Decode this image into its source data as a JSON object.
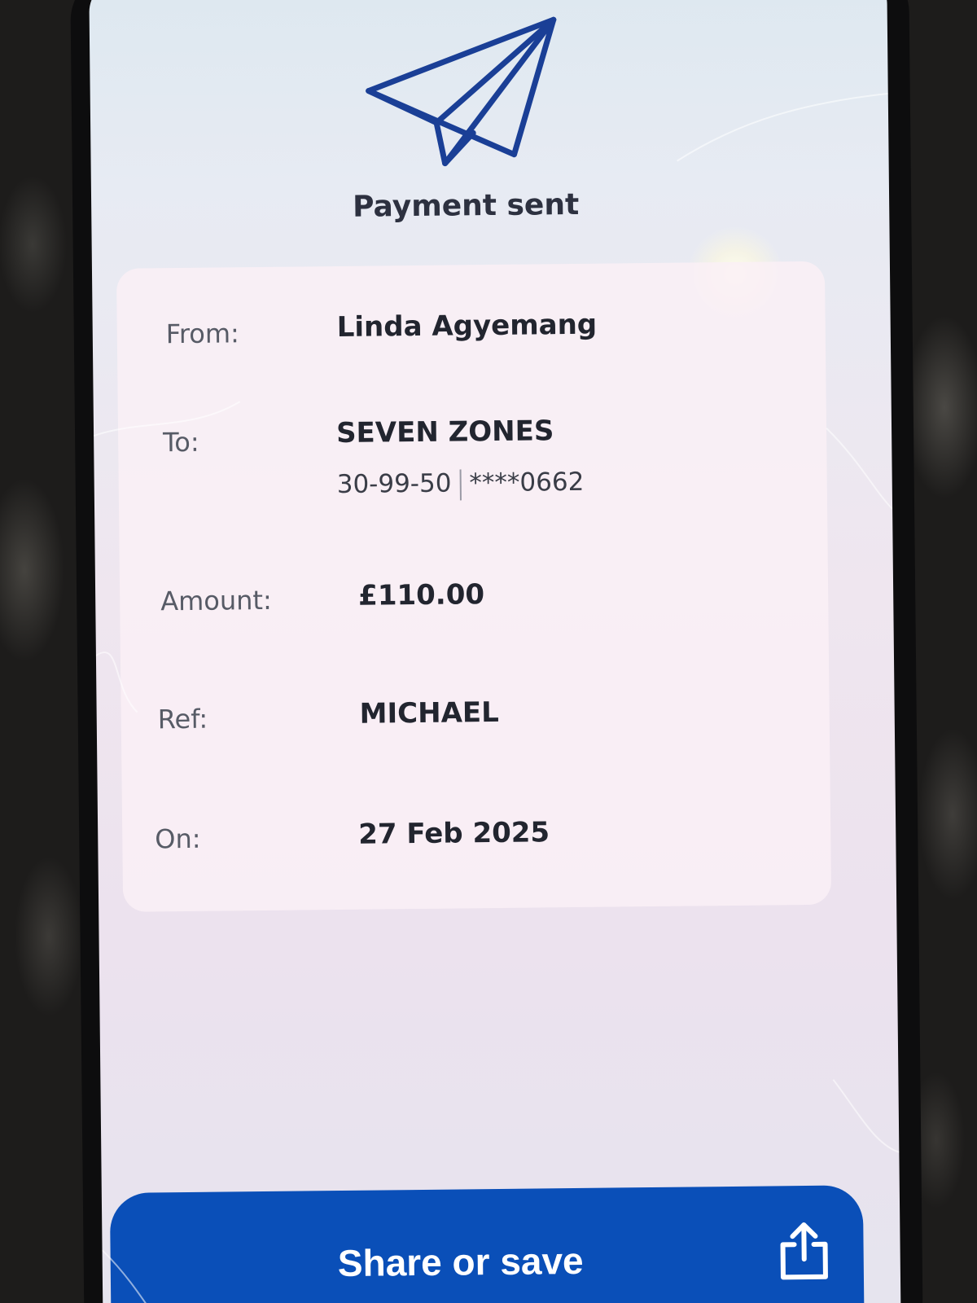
{
  "header": {
    "icon": "paper-plane-icon",
    "title": "Payment sent"
  },
  "details": {
    "from_label": "From:",
    "from_value": "Linda Agyemang",
    "to_label": "To:",
    "to_name": "SEVEN ZONES",
    "to_sort_code": "30-99-50",
    "to_account": "****0662",
    "amount_label": "Amount:",
    "amount_value": "£110.00",
    "ref_label": "Ref:",
    "ref_value": "MICHAEL",
    "on_label": "On:",
    "on_value": "27 Feb 2025"
  },
  "actions": {
    "share_label": "Share or save",
    "share_icon": "share-icon"
  },
  "colors": {
    "accent": "#0a4fb8",
    "icon": "#1a3f96"
  }
}
